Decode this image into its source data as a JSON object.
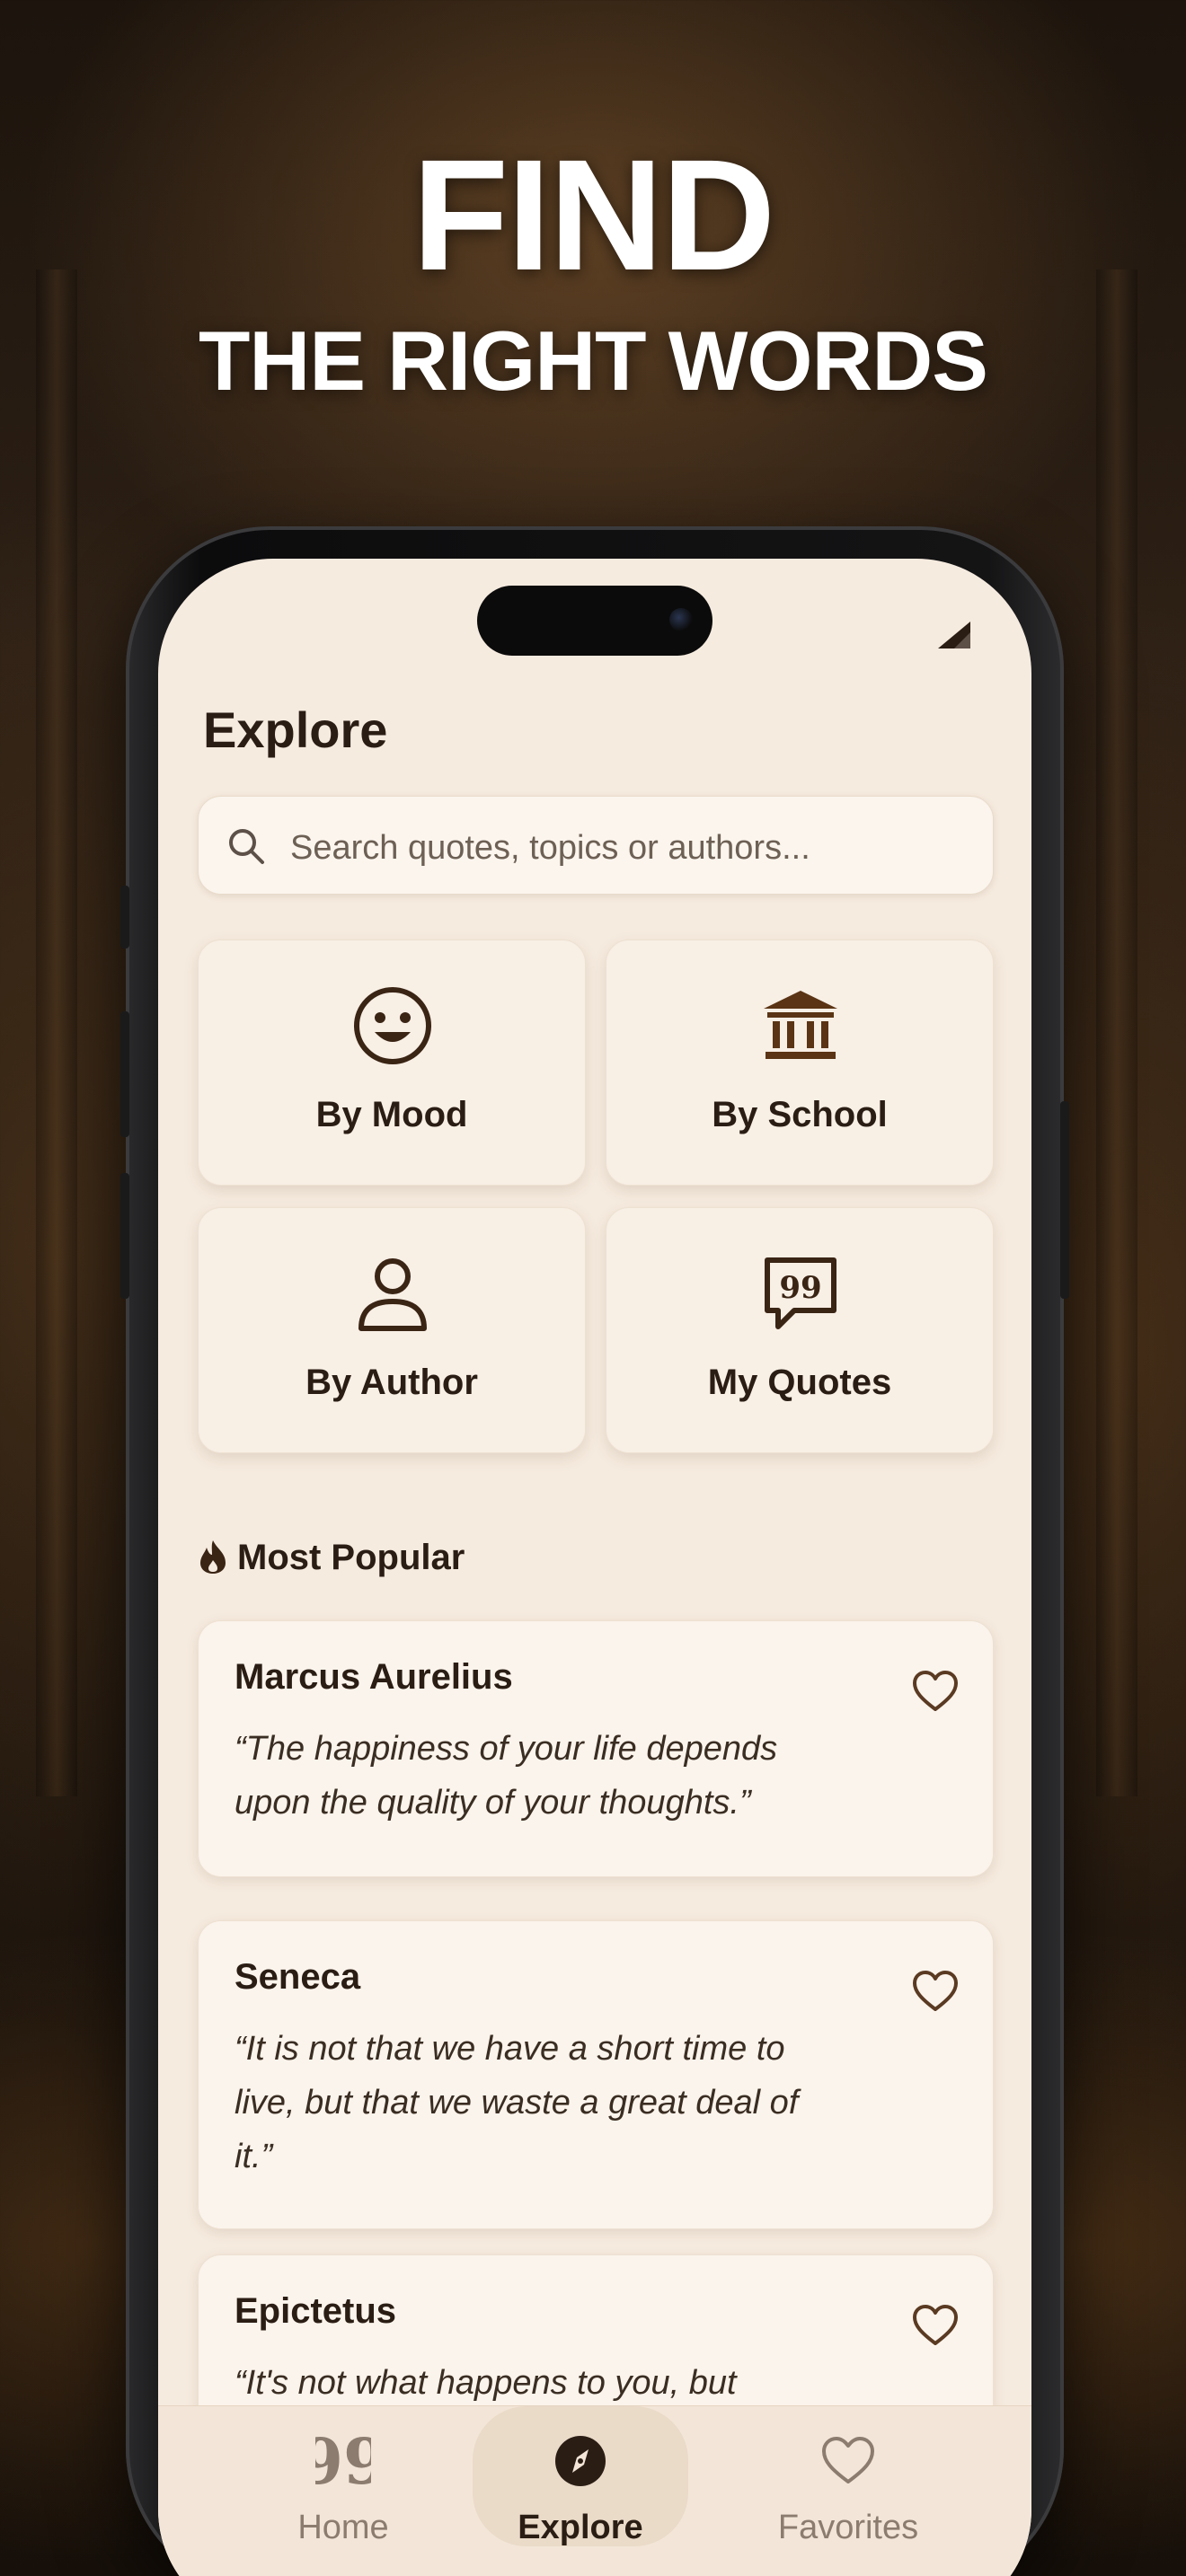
{
  "promo": {
    "headline_line1": "FIND",
    "headline_line2": "THE RIGHT WORDS"
  },
  "screen": {
    "title": "Explore",
    "search": {
      "placeholder": "Search quotes, topics or authors..."
    },
    "categories": [
      {
        "label": "By Mood",
        "icon": "smiley-icon"
      },
      {
        "label": "By School",
        "icon": "temple-icon"
      },
      {
        "label": "By Author",
        "icon": "person-icon"
      },
      {
        "label": "My Quotes",
        "icon": "quote-bubble-icon"
      }
    ],
    "section_title": "Most Popular",
    "quotes": [
      {
        "author": "Marcus Aurelius",
        "text": "“The happiness of your life depends upon the quality of your thoughts.”"
      },
      {
        "author": "Seneca",
        "text": "“It is not that we have a short time to live, but that we waste a great deal of it.”"
      },
      {
        "author": "Epictetus",
        "text": "“It's not what happens to you, but"
      }
    ],
    "tabs": [
      {
        "label": "Home",
        "icon": "quotes-icon",
        "active": false
      },
      {
        "label": "Explore",
        "icon": "compass-icon",
        "active": true
      },
      {
        "label": "Favorites",
        "icon": "heart-icon",
        "active": false
      }
    ]
  },
  "colors": {
    "accent_brown": "#5a3a22",
    "screen_bg": "#f6ebdf",
    "text_dark": "#2a1d14"
  }
}
